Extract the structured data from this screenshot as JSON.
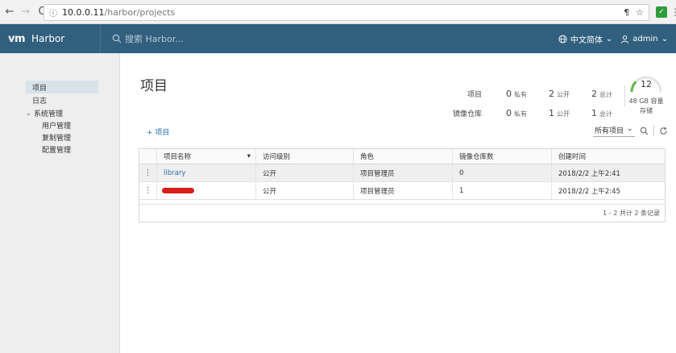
{
  "browser": {
    "url_prefix": "ⓘ",
    "url_host": "10.0.0.11",
    "url_path": "/harbor/projects"
  },
  "header": {
    "brand_logo": "vm",
    "brand_name": "Harbor",
    "search_placeholder": "搜索 Harbor...",
    "language": "中文简体",
    "user": "admin"
  },
  "sidebar": {
    "items": [
      {
        "label": "项目",
        "active": true
      },
      {
        "label": "日志",
        "active": false
      }
    ],
    "group_label": "系统管理",
    "sub_items": [
      "用户管理",
      "复制管理",
      "配置管理"
    ]
  },
  "main": {
    "title": "项目",
    "stats": {
      "rows": [
        {
          "label": "项目",
          "private_count": "0",
          "private_unit": "私有",
          "public_count": "2",
          "public_unit": "公开",
          "total_count": "2",
          "total_unit": "总计"
        },
        {
          "label": "镜像仓库",
          "private_count": "0",
          "private_unit": "私有",
          "public_count": "1",
          "public_unit": "公开",
          "total_count": "1",
          "total_unit": "总计"
        }
      ]
    },
    "storage": {
      "value": "12",
      "capacity": "48 GB 容量",
      "label": "存储",
      "usage_fraction": 0.25,
      "gauge_color": "#5fb548"
    },
    "add_button": "+ 项目",
    "filter_value": "所有项目",
    "table": {
      "columns": [
        "项目名称",
        "访问级别",
        "角色",
        "镜像仓库数",
        "创建时间"
      ],
      "rows": [
        {
          "name": "library",
          "access": "公开",
          "role": "项目管理员",
          "repos": "0",
          "created": "2018/2/2 上午2:41"
        },
        {
          "name": "",
          "access": "公开",
          "role": "项目管理员",
          "repos": "1",
          "created": "2018/2/2 上午2:45"
        }
      ],
      "footer": "1 - 2 共计 2 条记录"
    }
  },
  "colors": {
    "header_bg": "#315f7e",
    "link": "#2a6fb0",
    "redaction": "#d91c1c"
  }
}
